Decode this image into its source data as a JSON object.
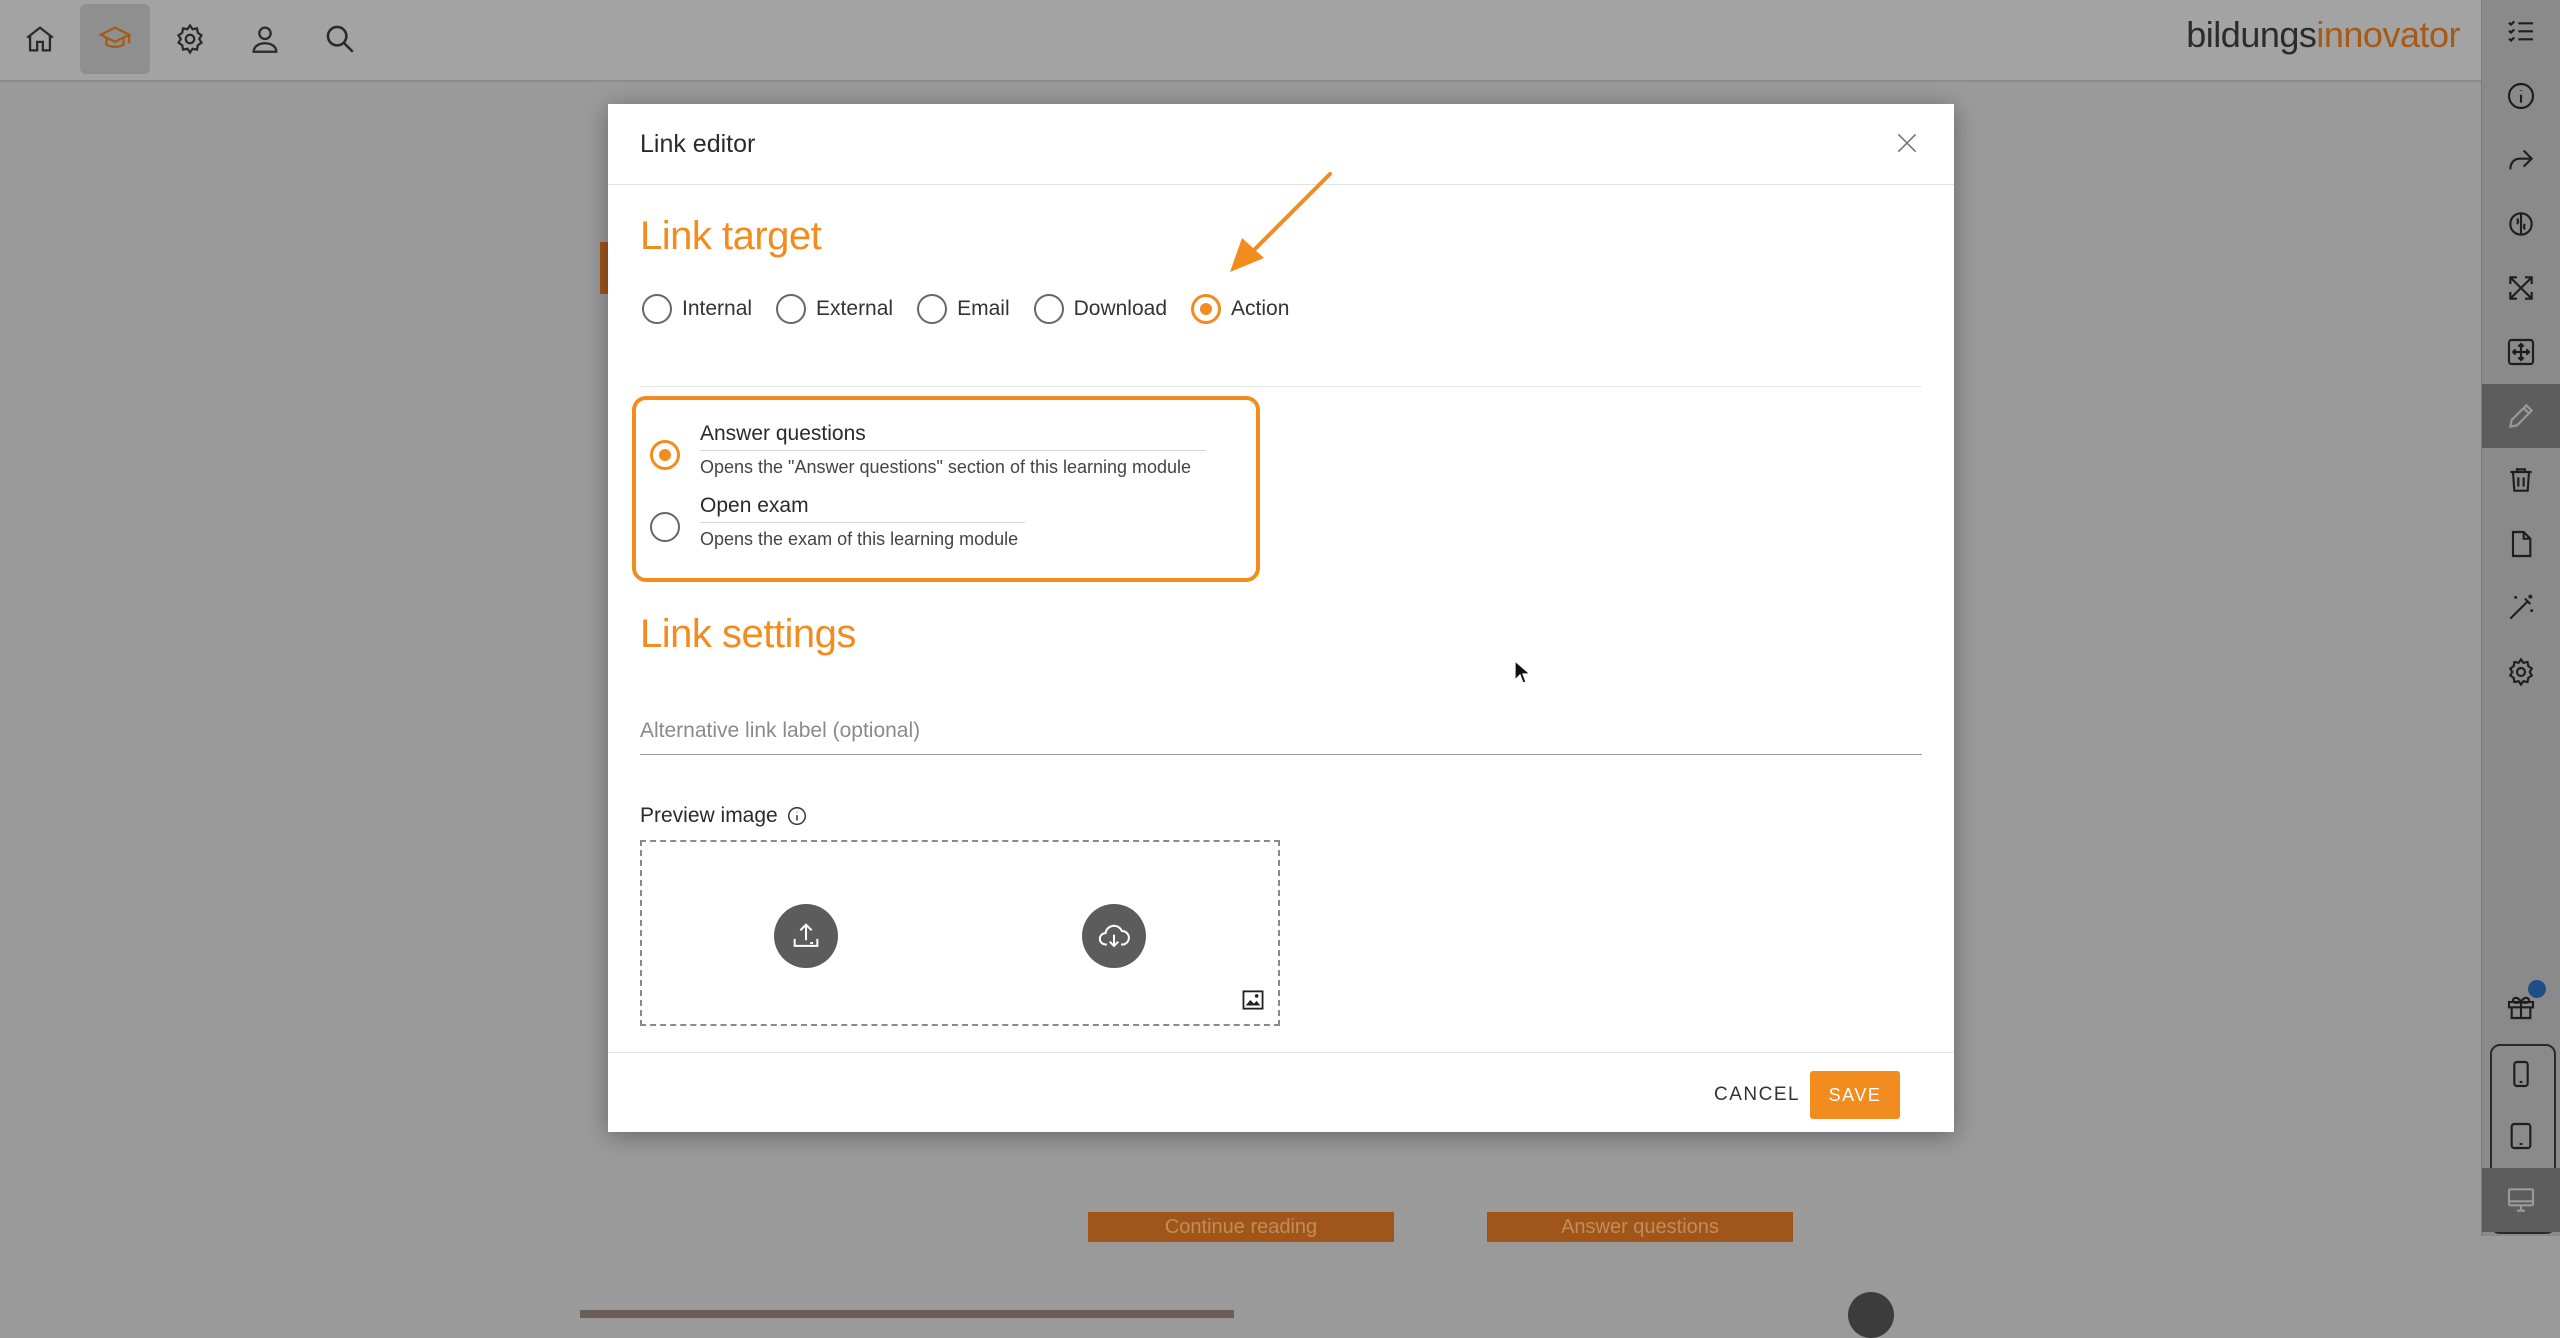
{
  "brand": {
    "name_part1": "bildungs",
    "name_part2": "innovator"
  },
  "topbar": {
    "icons": [
      "home-icon",
      "graduation-cap-icon",
      "settings-icon",
      "profile-icon",
      "search-icon"
    ]
  },
  "background": {
    "continue_button": "Continue reading",
    "answer_button": "Answer questions"
  },
  "modal": {
    "title": "Link editor",
    "link_target_title": "Link target",
    "link_types": [
      {
        "label": "Internal",
        "checked": false
      },
      {
        "label": "External",
        "checked": false
      },
      {
        "label": "Email",
        "checked": false
      },
      {
        "label": "Download",
        "checked": false
      },
      {
        "label": "Action",
        "checked": true
      }
    ],
    "actions": [
      {
        "title": "Answer questions",
        "description": "Opens the \"Answer questions\" section of this learning module",
        "checked": true
      },
      {
        "title": "Open exam",
        "description": "Opens the exam of this learning module",
        "checked": false
      }
    ],
    "link_settings_title": "Link settings",
    "alt_label_placeholder": "Alternative link label (optional)",
    "preview_image_label": "Preview image",
    "cancel_label": "CANCEL",
    "save_label": "SAVE"
  },
  "colors": {
    "accent": "#f28c1e",
    "sidebar": "#8a8a8a",
    "overlay": "#9a9a9a"
  },
  "sidebar": {
    "icons": [
      "checklist-icon",
      "info-icon",
      "share-icon",
      "brain-icon",
      "expand-icon",
      "fit-screen-icon",
      "pencil-icon",
      "trash-icon",
      "document-icon",
      "magic-wand-icon",
      "settings-icon",
      "gift-icon",
      "phone-icon",
      "tablet-icon",
      "desktop-icon"
    ],
    "active": "pencil-icon"
  }
}
